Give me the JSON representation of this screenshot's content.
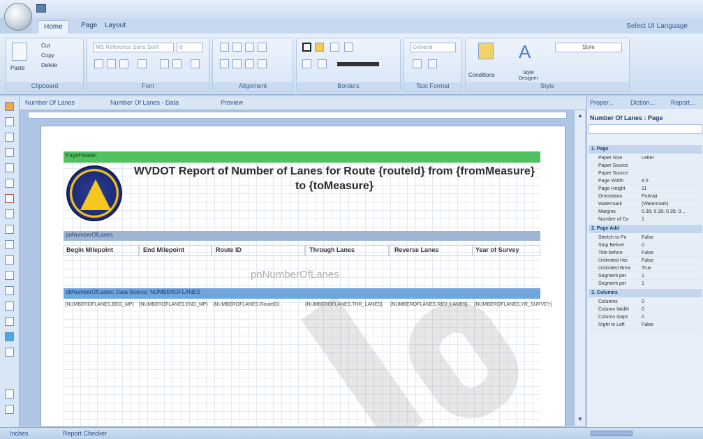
{
  "tabs": [
    "Home",
    "Page",
    "Layout"
  ],
  "language": "Select UI Language",
  "ribbon": {
    "groups": [
      "Clipboard",
      "Font",
      "Alignment",
      "Borders",
      "Text Format",
      "Style"
    ],
    "clipboard": {
      "paste": "Paste",
      "cut": "Cut",
      "copy": "Copy",
      "delete": "Delete"
    },
    "font_name": "MS Reference Sans Serif",
    "font_size": "8",
    "text_format": "General",
    "conditions": "Conditions",
    "style_designer": "Style Designer",
    "style_value": "Style"
  },
  "doc_tabs": [
    "Number Of Lanes",
    "Number Of Lanes - Data",
    "Preview"
  ],
  "report": {
    "page_header_band": "PageHeader",
    "title": "WVDOT Report of Number of Lanes for Route {routeId} from {fromMeasure} to {toMeasure}",
    "lanes_band": "pnNumberOfLanes",
    "columns": [
      "Begin Milepoint",
      "End Milepoint",
      "Route ID",
      "Through Lanes",
      "Reverse Lanes",
      "Year of Survey"
    ],
    "panel_watermark": "pnNumberOfLanes",
    "data_band": "dbNumberOfLanes; Data Source: NUMBEROFLANES",
    "expressions": [
      "{NUMBEROFLANES.BEG_MP}",
      "{NUMBEROFLANES.END_MP}",
      "{NUMBEROFLANES.RouteID}",
      "{NUMBEROFLANES.THR_LANES}",
      "{NUMBEROFLANES.REV_LANES}",
      "{NUMBEROFLANES.YR_SURVEY}"
    ]
  },
  "properties": {
    "tabs": [
      "Proper...",
      "Diction...",
      "Report..."
    ],
    "title": "Number Of Lanes : Page",
    "categories": {
      "page": "1. Page",
      "page_add": "2. Page Add",
      "columns": "3. Columns"
    },
    "page_rows": [
      {
        "name": "Paper Size",
        "value": "Letter"
      },
      {
        "name": "Paper Source",
        "value": ""
      },
      {
        "name": "Paper Source",
        "value": ""
      },
      {
        "name": "Page Width",
        "value": "8.5"
      },
      {
        "name": "Page Height",
        "value": "11"
      },
      {
        "name": "Orientation",
        "value": "Portrait"
      },
      {
        "name": "Watermark",
        "value": "(Watermark)"
      },
      {
        "name": "Margins",
        "value": "0.39; 0.39; 0.39; 0..."
      },
      {
        "name": "Number of Co",
        "value": "1"
      }
    ],
    "page_add_rows": [
      {
        "name": "Stretch to Pri",
        "value": "False"
      },
      {
        "name": "Stop Before",
        "value": "0"
      },
      {
        "name": "Title before",
        "value": "False"
      },
      {
        "name": "Unlimited Hei",
        "value": "False"
      },
      {
        "name": "Unlimited Brea",
        "value": "True"
      },
      {
        "name": "Segment per",
        "value": "1"
      },
      {
        "name": "Segment per",
        "value": "1"
      }
    ],
    "column_rows": [
      {
        "name": "Columns",
        "value": "0"
      },
      {
        "name": "Column Width",
        "value": "0"
      },
      {
        "name": "Column Gaps",
        "value": "0"
      },
      {
        "name": "Right to Left",
        "value": "False"
      }
    ]
  },
  "status": {
    "units": "Inches",
    "checker": "Report Checker"
  }
}
